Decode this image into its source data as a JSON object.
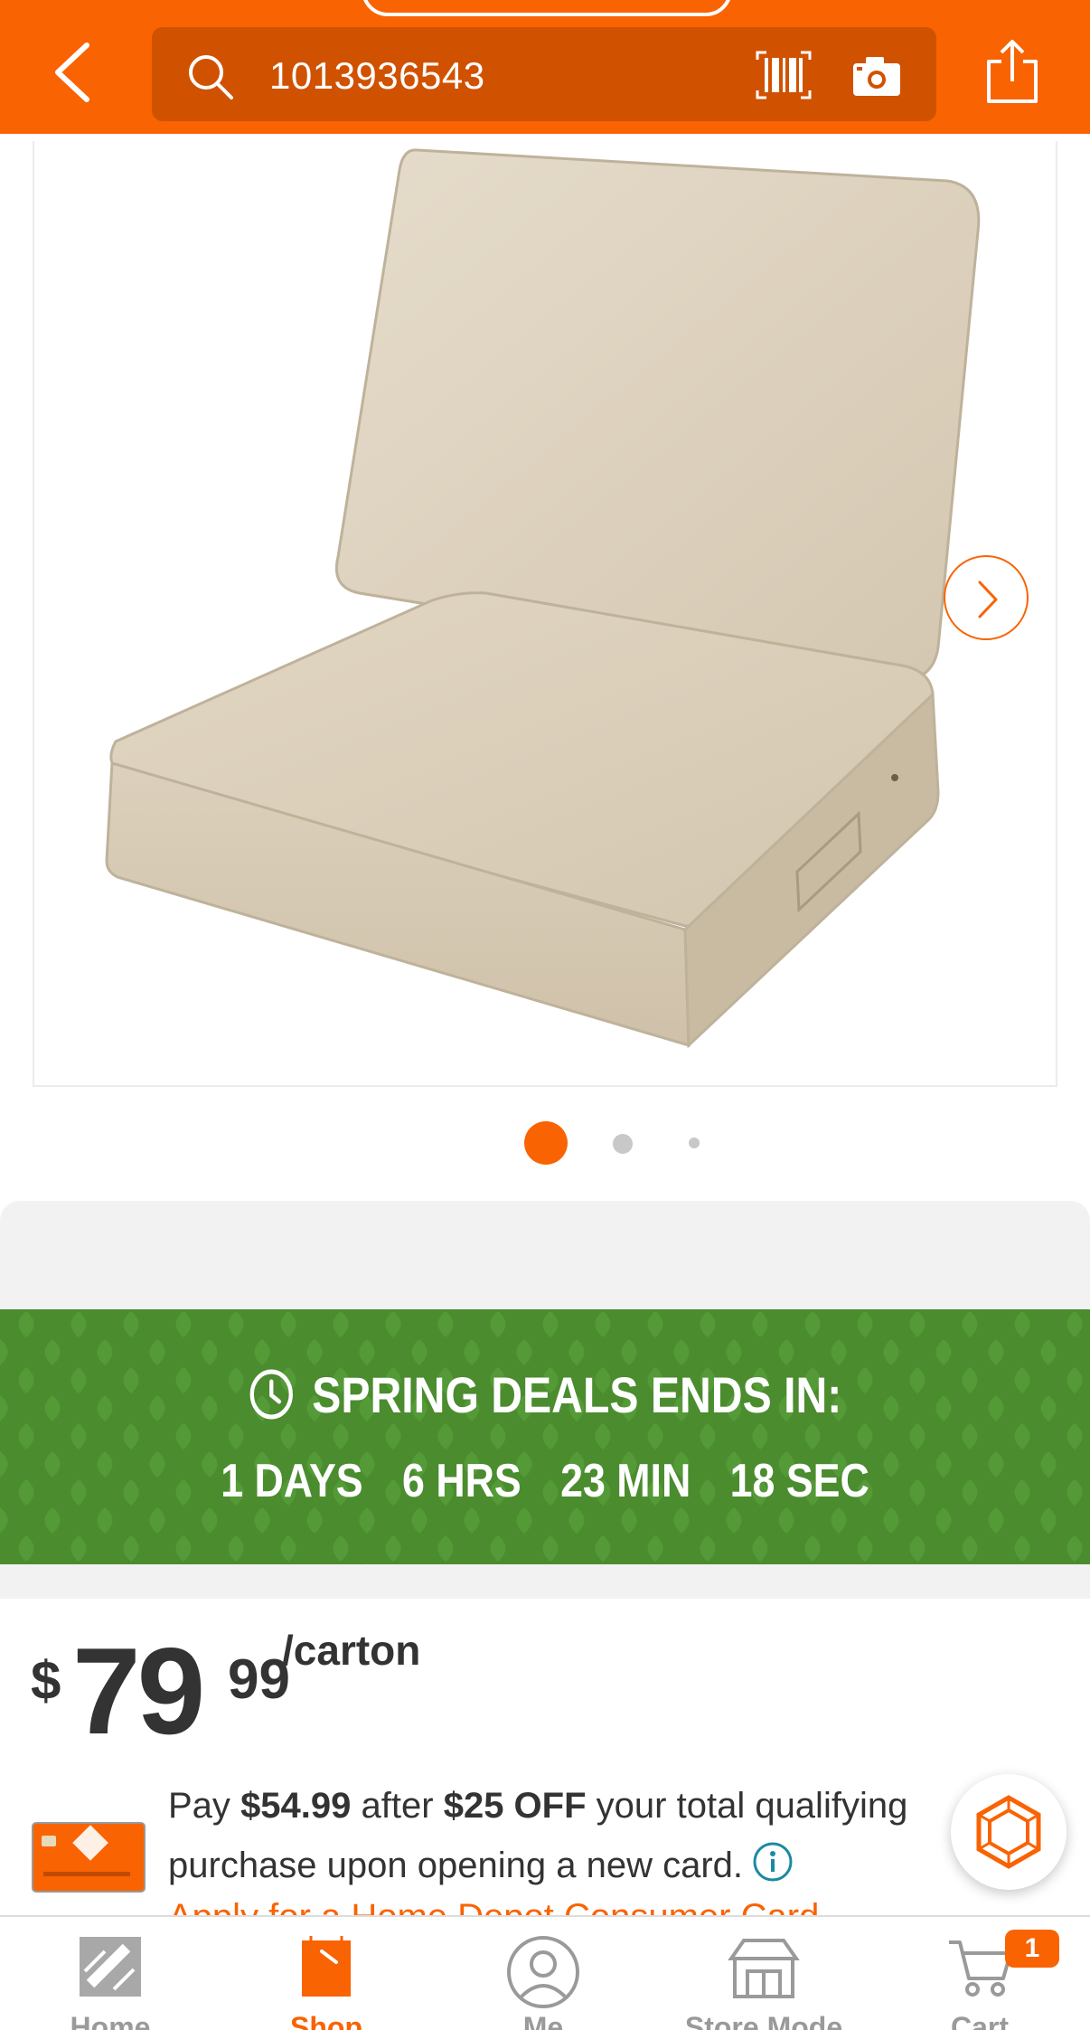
{
  "header": {
    "search_query": "1013936543",
    "brand_color": "#f96302"
  },
  "gallery": {
    "image_count": 3,
    "active_index": 0,
    "product_alt": "Beige outdoor deep seating cushion set"
  },
  "promo": {
    "title": "SPRING DEALS ENDS IN:",
    "days": "1 DAYS",
    "hours": "6 HRS",
    "minutes": "23 MIN",
    "seconds": "18 SEC",
    "banner_color": "#4b8c2f"
  },
  "price": {
    "currency": "$",
    "whole": "79",
    "cents": "99",
    "unit": "/carton"
  },
  "offer": {
    "pay": "Pay",
    "amount": "$54.99",
    "after": "after",
    "discount": "$25 OFF",
    "rest_line1": "your total qualifying",
    "rest_line2": "purchase upon opening a new card.",
    "apply_link": "Apply for a Home Depot Consumer Card"
  },
  "bottom_nav": {
    "items": [
      {
        "label": "Home",
        "icon": "home-depot-logo-icon"
      },
      {
        "label": "Shop",
        "icon": "shop-bag-icon"
      },
      {
        "label": "Me",
        "icon": "user-icon"
      },
      {
        "label": "Store Mode",
        "icon": "store-icon"
      },
      {
        "label": "Cart",
        "icon": "cart-icon"
      }
    ],
    "active": "Shop",
    "cart_count": "1"
  }
}
